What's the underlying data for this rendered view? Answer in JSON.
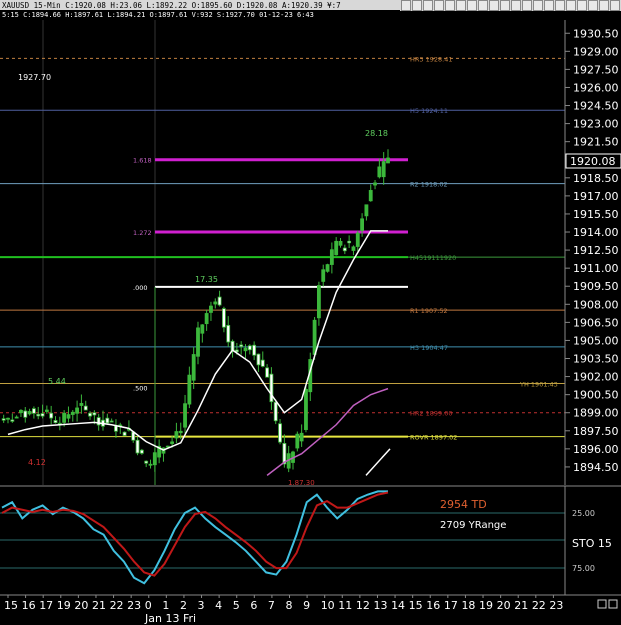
{
  "info_bar": {
    "text_line1": "XAUUSD 15-Min  C:1920.08 H:23.06 L:1892.22 O:1895.60 D:1920.08 A:1920.39 ¥:7",
    "text_line2": "5:15 C:1894.66 H:1897.61 L:1894.21 O:1897.61 V:932 S:1927.70 01-12-23 6:43"
  },
  "price_axis": {
    "ticks": [
      "1930.50",
      "1929.00",
      "1927.50",
      "1926.00",
      "1924.50",
      "1923.00",
      "1921.50",
      "1920.00",
      "1918.50",
      "1917.00",
      "1915.50",
      "1914.00",
      "1912.50",
      "1911.00",
      "1909.50",
      "1908.00",
      "1906.50",
      "1905.00",
      "1903.50",
      "1902.00",
      "1900.50",
      "1899.00",
      "1897.50",
      "1896.00",
      "1894.50"
    ],
    "current_price": "1920.08"
  },
  "time_axis": {
    "hour_labels": [
      "15",
      "16",
      "17",
      "19",
      "20",
      "21",
      "22",
      "23",
      "0",
      "1",
      "2",
      "3",
      "4",
      "5",
      "6",
      "7",
      "8",
      "9",
      "10",
      "11",
      "12",
      "13",
      "14",
      "15",
      "16",
      "17",
      "18",
      "19",
      "20",
      "21",
      "22",
      "23"
    ],
    "date_label": "Jan 13 Fri"
  },
  "annotations": {
    "prev_high_label": "1927.70",
    "fib_1618": "1.618",
    "fib_1272": "1.272",
    "fib_000": ".000",
    "fib_500": ".500",
    "swing_28": "28.18",
    "swing_17": "17.35",
    "swing_544": "5.44",
    "swing_412": "4.12",
    "swing_low": "1.87.30"
  },
  "levels": [
    {
      "label": "HR3 1928.41",
      "price": 1928.41,
      "color": "#c08040",
      "dash": true
    },
    {
      "label": "H5 1924.11",
      "price": 1924.11,
      "color": "#5060a0",
      "dash": false
    },
    {
      "label": "R2 1918.02",
      "price": 1918.02,
      "color": "#70a0c0",
      "dash": false
    },
    {
      "label": "H4519111920",
      "price": 1911.92,
      "color": "#3c9a3c",
      "dash": false
    },
    {
      "label": "R1 1907.52",
      "price": 1907.52,
      "color": "#c07840",
      "dash": false
    },
    {
      "label": "H3 1904.47",
      "price": 1904.47,
      "color": "#4090b0",
      "dash": false
    },
    {
      "label": "YH 1901.43",
      "price": 1901.43,
      "color": "#c0a040",
      "dash": false
    },
    {
      "label": "HR2 1899.00",
      "price": 1899.0,
      "color": "#c03030",
      "dash": true
    },
    {
      "label": "ROVR 1897.02",
      "price": 1897.02,
      "color": "#e0e040",
      "dash": false
    }
  ],
  "indicator": {
    "td_label": "2954 TD",
    "range_label": "2709 YRange",
    "sto_label": "STO  15",
    "level_25": "25.00",
    "level_75": "75.00",
    "colors": {
      "fast": "#40c0e0",
      "slow": "#c01818"
    }
  },
  "colors": {
    "background": "#000000",
    "bull_candle": "#3cb83c",
    "bear_candle": "#000000",
    "ma_fast": "#ffffff",
    "ma_slow": "#c060c0",
    "magenta_level": "#d020d0",
    "green_band": "#20c020",
    "yellow_band": "#e8e840",
    "white_band": "#ffffff"
  },
  "chart_data": {
    "type": "candlestick",
    "title": "",
    "ylim": [
      1893.5,
      1931.0
    ],
    "x": [
      "15",
      "16",
      "17",
      "19",
      "20",
      "21",
      "22",
      "23",
      "0",
      "1",
      "2",
      "3",
      "4",
      "5",
      "6",
      "7",
      "8",
      "9",
      "10",
      "11",
      "12",
      "13",
      "14"
    ],
    "close": [
      1898.4,
      1898.9,
      1899.1,
      1898.2,
      1899.6,
      1898.6,
      1897.9,
      1897.4,
      1894.7,
      1896.2,
      1897.8,
      1905.6,
      1908.6,
      1904.2,
      1904.6,
      1902.2,
      1894.4,
      1897.6,
      1909.9,
      1912.9,
      1912.8,
      1917.9,
      1920.08
    ],
    "fast_ma": [
      1897.2,
      1897.6,
      1897.9,
      1898.0,
      1898.1,
      1898.2,
      1898.0,
      1897.7,
      1896.6,
      1895.9,
      1896.5,
      1899.2,
      1902.2,
      1904.2,
      1903.2,
      1901.0,
      1899.0,
      1900.1,
      1904.9,
      1909.0,
      1911.7,
      1914.1,
      1914.1
    ],
    "slow_ma": [
      null,
      null,
      null,
      null,
      null,
      null,
      null,
      null,
      null,
      null,
      null,
      null,
      null,
      null,
      null,
      1893.8,
      1894.9,
      1895.6,
      1896.8,
      1898.0,
      1899.6,
      1900.5,
      1901.0
    ]
  }
}
